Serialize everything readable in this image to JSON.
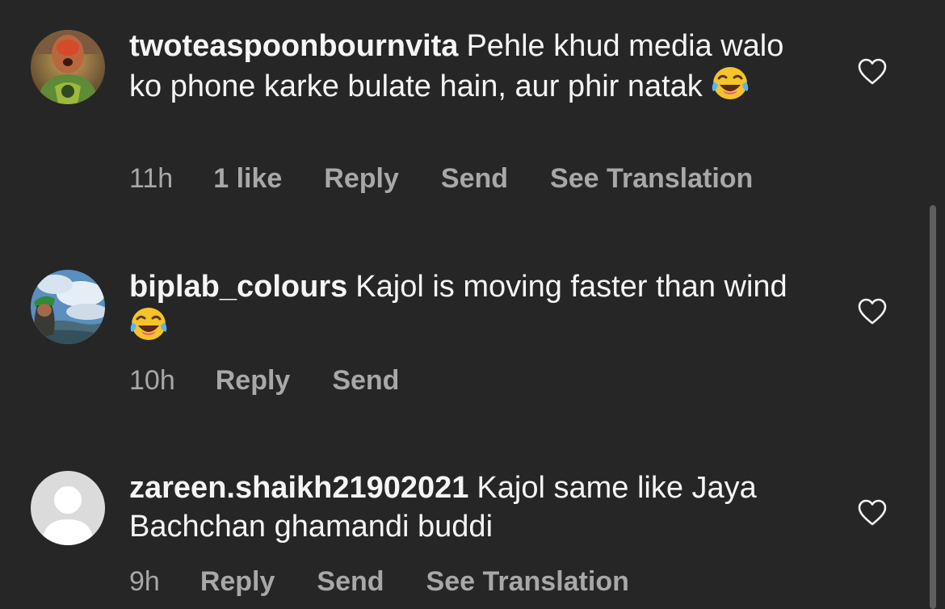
{
  "comments": [
    {
      "username": "twoteaspoonbournvita",
      "text": "Pehle khud media walo ko phone karke bulate hain, aur phir natak",
      "emoji": "face-with-tears-of-joy-icon",
      "time": "11h",
      "likes": "1 like",
      "reply": "Reply",
      "send": "Send",
      "translate": "See Translation"
    },
    {
      "username": "biplab_colours",
      "text": "Kajol is moving faster than wind",
      "emoji": "face-with-tears-of-joy-icon",
      "time": "10h",
      "reply": "Reply",
      "send": "Send"
    },
    {
      "username": "zareen.shaikh21902021",
      "text": "Kajol same like Jaya Bachchan ghamandi buddi",
      "time": "9h",
      "reply": "Reply",
      "send": "Send",
      "translate": "See Translation"
    }
  ],
  "icons": {
    "like": "heart-outline-icon",
    "default_avatar": "default-profile-icon"
  },
  "colors": {
    "background": "#262626",
    "text": "#f5f5f5",
    "meta": "#a8a8a8"
  }
}
